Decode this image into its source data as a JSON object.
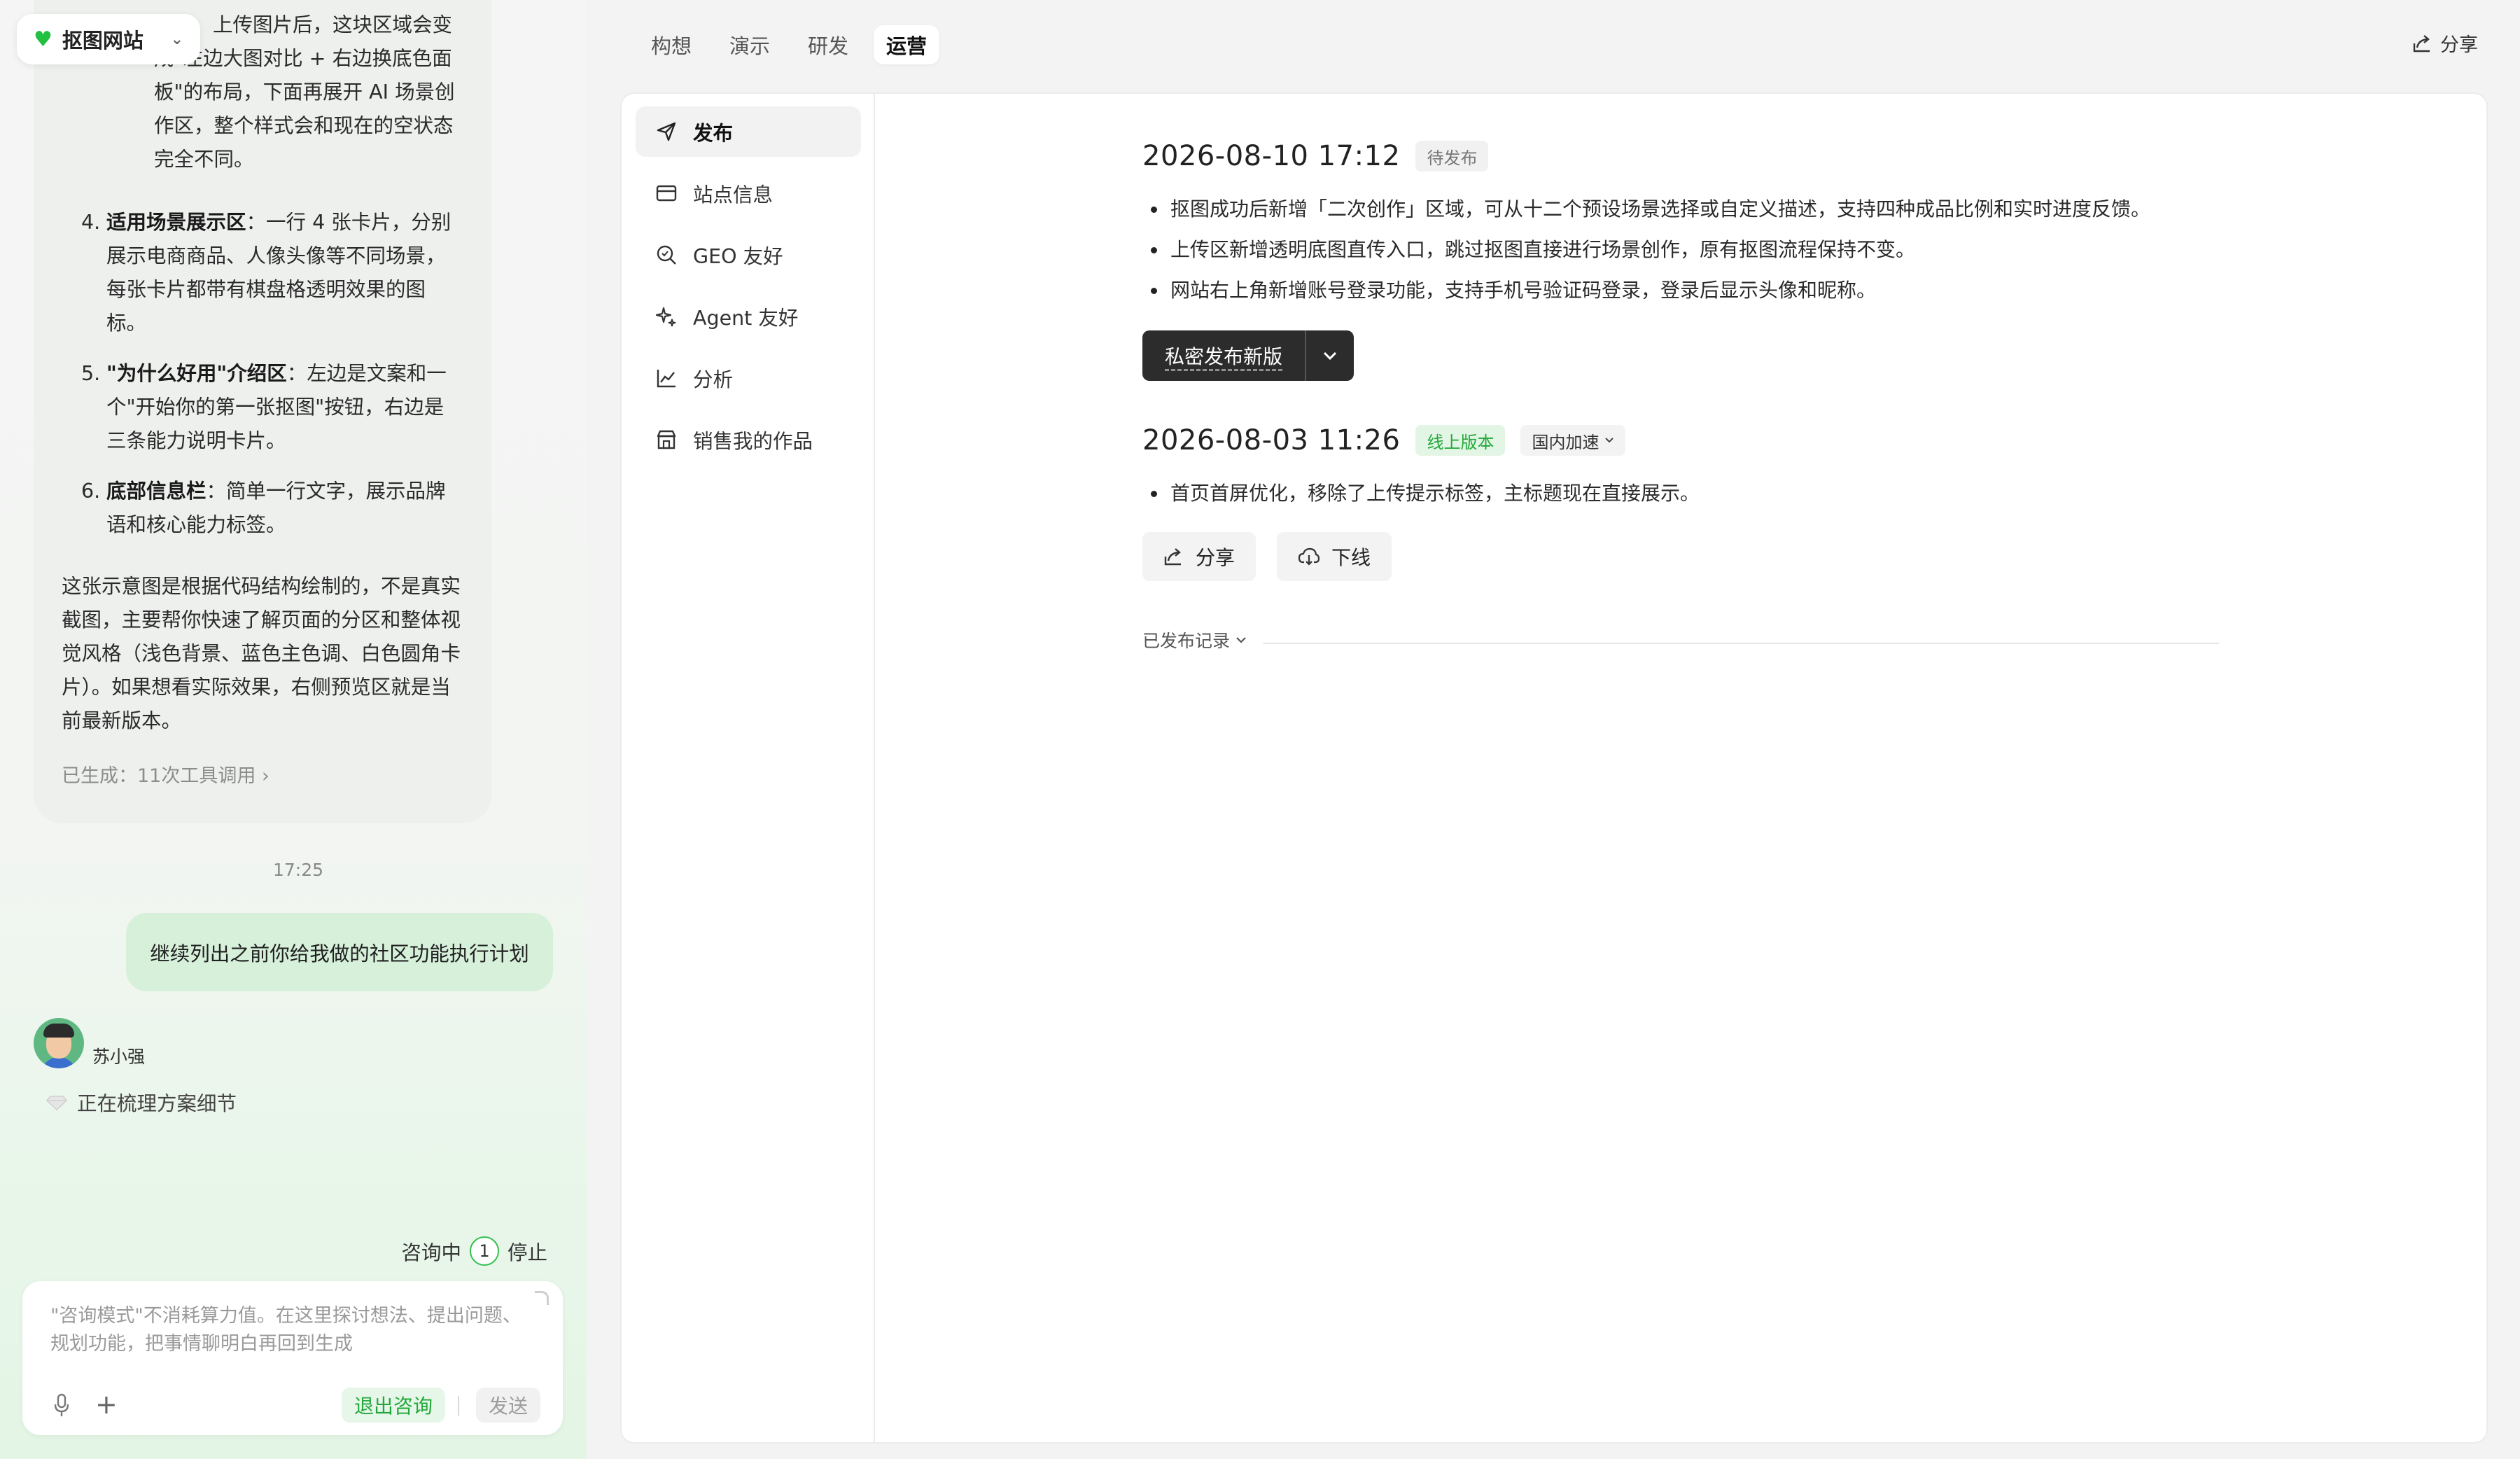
{
  "site_switcher": {
    "label": "抠图网站"
  },
  "chat": {
    "intro_lines": [
      "上传图片后，这块区域会变",
      "成\"左边大图对比 + 右边换底色面",
      "板\"的布局，下面再展开 AI 场景创",
      "作区，整个样式会和现在的空状态",
      "完全不同。"
    ],
    "items": [
      {
        "num": "4.",
        "title": "适用场景展示区",
        "lines": [
          "：一行 4 张卡片，分别",
          "展示电商商品、人像头像等不同场景，",
          "每张卡片都带有棋盘格透明效果的图",
          "标。"
        ]
      },
      {
        "num": "5.",
        "title": "\"为什么好用\"介绍区",
        "lines": [
          "：左边是文案和一",
          "个\"开始你的第一张抠图\"按钮，右边是",
          "三条能力说明卡片。"
        ]
      },
      {
        "num": "6.",
        "title": "底部信息栏",
        "lines": [
          "：简单一行文字，展示品牌",
          "语和核心能力标签。"
        ]
      }
    ],
    "summary_lines": [
      "这张示意图是根据代码结构绘制的，不是真实",
      "截图，主要帮你快速了解页面的分区和整体视",
      "觉风格（浅色背景、蓝色主色调、白色圆角卡",
      "片）。如果想看实际效果，右侧预览区就是当",
      "前最新版本。"
    ],
    "generated_tools": "已生成：11次工具调用",
    "timestamp": "17:25",
    "user_message": "继续列出之前你给我做的社区功能执行计划",
    "agent_name": "苏小强",
    "agent_status": "正在梳理方案细节",
    "consult": {
      "label": "咨询中",
      "count": "1",
      "stop": "停止"
    },
    "composer": {
      "placeholder": "\"咨询模式\"不消耗算力值。在这里探讨想法、提出问题、规划功能，把事情聊明白再回到生成",
      "exit_label": "退出咨询",
      "send_label": "发送"
    }
  },
  "tabs": [
    {
      "label": "构想",
      "active": false
    },
    {
      "label": "演示",
      "active": false
    },
    {
      "label": "研发",
      "active": false
    },
    {
      "label": "运营",
      "active": true
    }
  ],
  "share_top": "分享",
  "sidenav": [
    {
      "label": "发布",
      "icon": "send-icon",
      "active": true
    },
    {
      "label": "站点信息",
      "icon": "card-icon",
      "active": false
    },
    {
      "label": "GEO 友好",
      "icon": "search-icon",
      "active": false
    },
    {
      "label": "Agent 友好",
      "icon": "sparkle-icon",
      "active": false
    },
    {
      "label": "分析",
      "icon": "chart-icon",
      "active": false
    },
    {
      "label": "销售我的作品",
      "icon": "store-icon",
      "active": false
    }
  ],
  "releases": [
    {
      "date": "2026-08-10 17:12",
      "badge": "待发布",
      "notes": [
        "抠图成功后新增「二次创作」区域，可从十二个预设场景选择或自定义描述，支持四种成品比例和实时进度反馈。",
        "上传区新增透明底图直传入口，跳过抠图直接进行场景创作，原有抠图流程保持不变。",
        "网站右上角新增账号登录功能，支持手机号验证码登录，登录后显示头像和昵称。"
      ],
      "action": "私密发布新版"
    },
    {
      "date": "2026-08-03 11:26",
      "badge": "线上版本",
      "region": "国内加速",
      "notes": [
        "首页首屏优化，移除了上传提示标签，主标题现在直接展示。"
      ],
      "share_label": "分享",
      "offline_label": "下线"
    }
  ],
  "history_label": "已发布记录",
  "colors": {
    "accent_green": "#22a83a",
    "dark_button": "#2c2c2c"
  }
}
